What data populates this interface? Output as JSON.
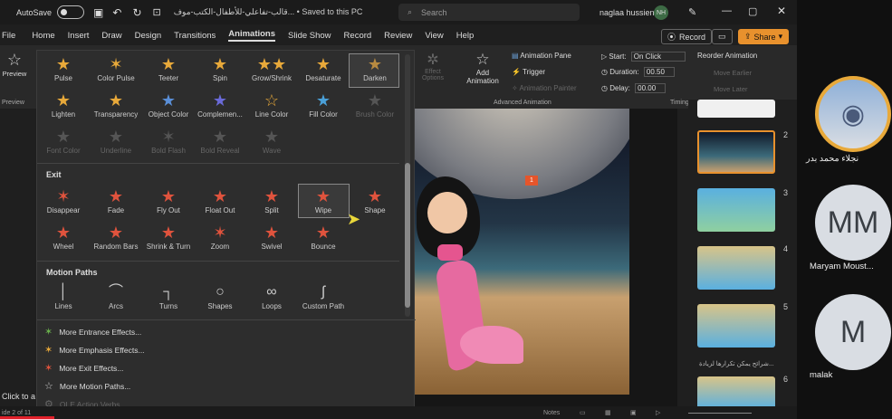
{
  "title_bar": {
    "autosave_label": "AutoSave",
    "autosave_state": "Off",
    "document_title": "قالب-تفاعلي-للأطفال-الكتب-موف...  •  Saved to this PC",
    "search_placeholder": "Search",
    "user_name": "naglaa hussien",
    "user_initials": "NH"
  },
  "menu": {
    "tabs": [
      "File",
      "Home",
      "Insert",
      "Draw",
      "Design",
      "Transitions",
      "Animations",
      "Slide Show",
      "Record",
      "Review",
      "View",
      "Help"
    ],
    "active_tab": "Animations",
    "record_label": "Record",
    "share_label": "Share"
  },
  "ribbon": {
    "preview_label": "Preview",
    "preview_group": "Preview",
    "effect_options": "Effect Options",
    "add_animation": "Add Animation",
    "animation_pane": "Animation Pane",
    "trigger": "Trigger",
    "animation_painter": "Animation Painter",
    "advanced_group": "Advanced Animation",
    "start_label": "Start:",
    "start_value": "On Click",
    "duration_label": "Duration:",
    "duration_value": "00.50",
    "delay_label": "Delay:",
    "delay_value": "00.00",
    "timing_group": "Timing",
    "reorder_label": "Reorder Animation",
    "move_earlier": "Move Earlier",
    "move_later": "Move Later"
  },
  "gallery": {
    "emphasis_row1": [
      "Pulse",
      "Color Pulse",
      "Teeter",
      "Spin",
      "Grow/Shrink",
      "Desaturate",
      "Darken"
    ],
    "emphasis_row2": [
      "Lighten",
      "Transparency",
      "Object Color",
      "Complemen...",
      "Line Color",
      "Fill Color",
      "Brush Color"
    ],
    "emphasis_row3": [
      "Font Color",
      "Underline",
      "Bold Flash",
      "Bold Reveal",
      "Wave"
    ],
    "exit_title": "Exit",
    "exit_row1": [
      "Disappear",
      "Fade",
      "Fly Out",
      "Float Out",
      "Split",
      "Wipe",
      "Shape"
    ],
    "exit_row2": [
      "Wheel",
      "Random Bars",
      "Shrink & Turn",
      "Zoom",
      "Swivel",
      "Bounce"
    ],
    "motion_title": "Motion Paths",
    "motion_row": [
      "Lines",
      "Arcs",
      "Turns",
      "Shapes",
      "Loops",
      "Custom Path"
    ],
    "more": [
      "More Entrance Effects...",
      "More Emphasis Effects...",
      "More Exit Effects...",
      "More Motion Paths...",
      "OLE Action Verbs..."
    ]
  },
  "slide": {
    "animation_tag": "1"
  },
  "thumbnails": {
    "numbers": [
      "2",
      "3",
      "4",
      "5",
      "6"
    ],
    "caption": "شرائح يمكن تكرارها لزيادة..."
  },
  "participants": [
    {
      "name": "نجلاء محمد بدر",
      "initials": ""
    },
    {
      "name": "Maryam Moust...",
      "initials": "MM"
    },
    {
      "name": "malak",
      "initials": "M"
    }
  ],
  "status": {
    "slide_info": "ide 2 of 11",
    "click_hint": "Click to a",
    "notes_label": "Notes"
  }
}
